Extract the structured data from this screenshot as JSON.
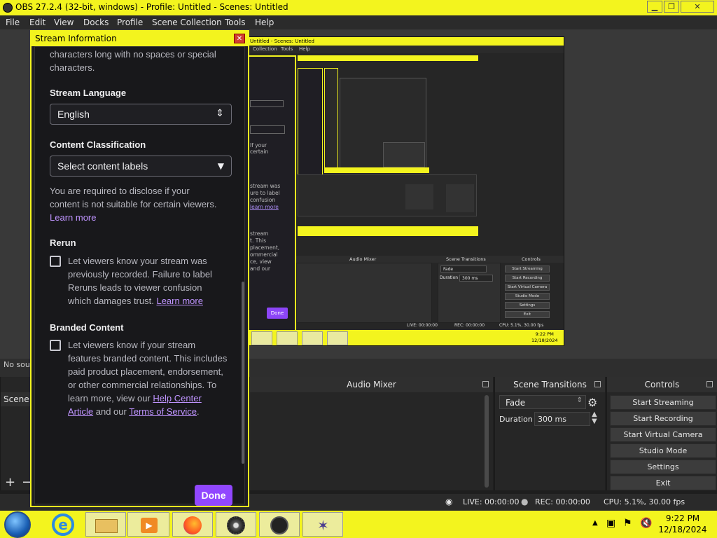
{
  "app": {
    "title": "OBS 27.2.4 (32-bit, windows) - Profile: Untitled - Scenes: Untitled"
  },
  "menu": [
    "File",
    "Edit",
    "View",
    "Docks",
    "Profile",
    "Scene Collection",
    "Tools",
    "Help"
  ],
  "preview": {
    "inner_title": "Untitled - Scenes: Untitled",
    "inner_menu": [
      "Collection",
      "Tools",
      "Help"
    ],
    "inner_dialog_lines": [
      "If your",
      "certain",
      "stream was",
      "ure to label",
      "confusion",
      "learn more",
      "stream",
      "t. This",
      "placement,",
      "ommercial",
      "ce, view",
      "and our"
    ],
    "inner_done": "Done",
    "inner_docks": {
      "audio_mixer": "Audio Mixer",
      "scene_transitions": "Scene Transitions",
      "controls": "Controls",
      "fade": "Fade",
      "duration_label": "Duration",
      "duration_value": "300 ms"
    },
    "inner_buttons": [
      "Start Streaming",
      "Start Recording",
      "Start Virtual Camera",
      "Studio Mode",
      "Settings",
      "Exit"
    ],
    "inner_status": {
      "live": "LIVE: 00:00:00",
      "rec": "REC: 00:00:00",
      "cpu": "CPU: 5.1%, 30.00 fps"
    },
    "inner_clock": {
      "time": "9:22 PM",
      "date": "12/18/2024"
    }
  },
  "toolbar": {
    "no_source": "No sou"
  },
  "docks": {
    "scenes": {
      "title": "Scene"
    },
    "audio_mixer": {
      "title": "Audio Mixer"
    },
    "scene_transitions": {
      "title": "Scene Transitions",
      "transition": "Fade",
      "duration_label": "Duration",
      "duration_value": "300 ms"
    },
    "controls": {
      "title": "Controls",
      "buttons": [
        "Start Streaming",
        "Start Recording",
        "Start Virtual Camera",
        "Studio Mode",
        "Settings",
        "Exit"
      ]
    }
  },
  "status": {
    "live": "LIVE: 00:00:00",
    "rec": "REC: 00:00:00",
    "cpu": "CPU: 5.1%, 30.00 fps"
  },
  "taskbar": {
    "time": "9:22 PM",
    "date": "12/18/2024"
  },
  "dialog": {
    "title": "Stream Information",
    "close": "✕",
    "intro_text": "characters long with no spaces or special characters.",
    "language": {
      "heading": "Stream Language",
      "value": "English"
    },
    "classification": {
      "heading": "Content Classification",
      "placeholder": "Select content labels",
      "disclaimer": "You are required to disclose if your content is not suitable for certain viewers.",
      "learn_more": "Learn more"
    },
    "rerun": {
      "heading": "Rerun",
      "text": "Let viewers know your stream was previously recorded. Failure to label Reruns leads to viewer confusion which damages trust.",
      "learn_more": "Learn more"
    },
    "branded": {
      "heading": "Branded Content",
      "text": "Let viewers know if your stream features branded content. This includes paid product placement, endorsement, or other commercial relationships. To learn more, view our",
      "link1": "Help Center Article",
      "and": "and our",
      "link2": "Terms of Service",
      "period": "."
    },
    "done": "Done"
  },
  "colors": {
    "accent": "#9147ff",
    "link": "#bf94ff",
    "window_frame": "#f3f41e"
  }
}
